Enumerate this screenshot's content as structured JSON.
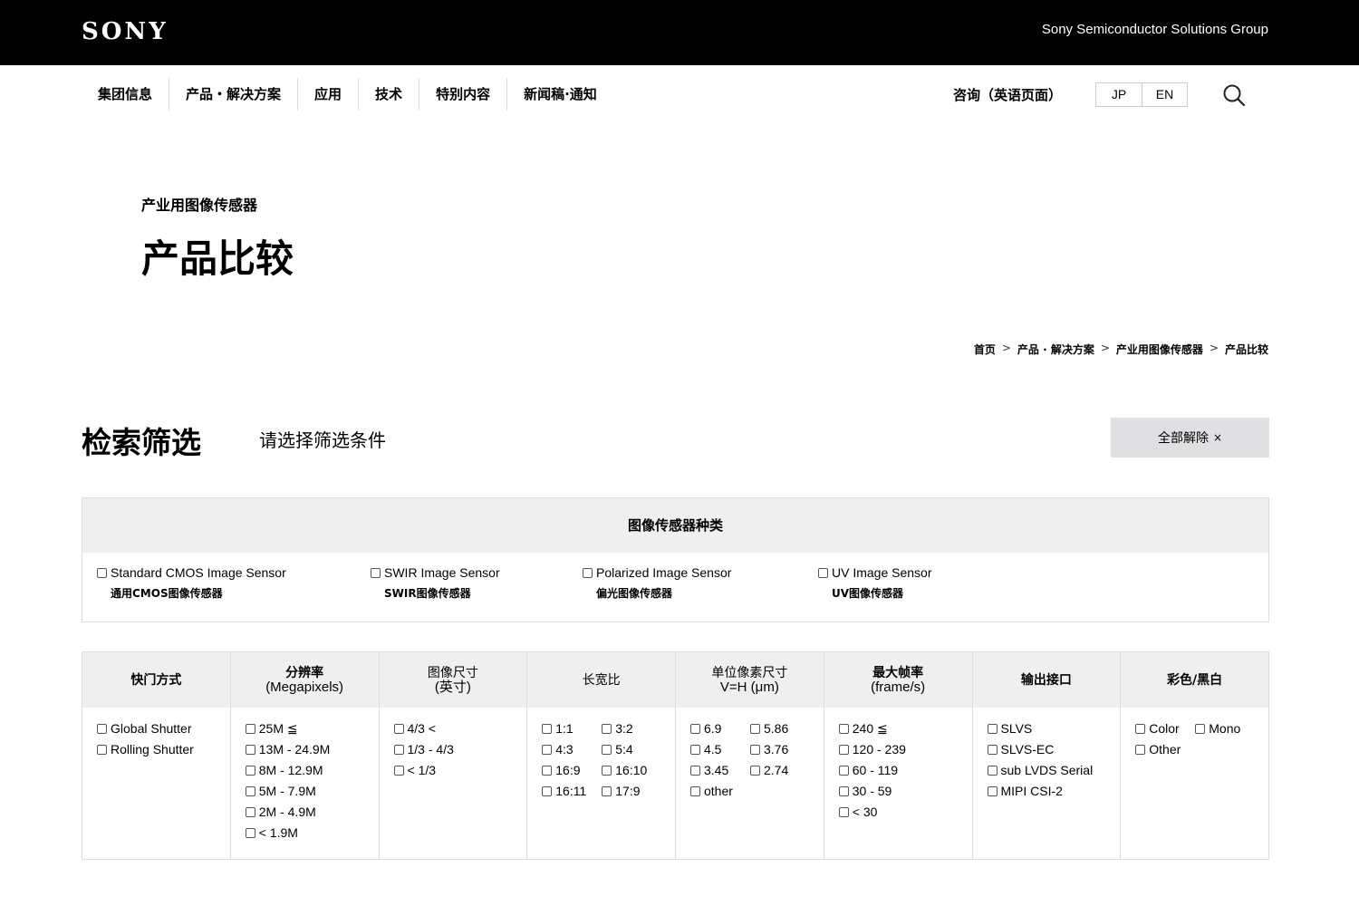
{
  "header": {
    "logo": "SONY",
    "group_name": "Sony Semiconductor Solutions Group"
  },
  "nav": {
    "items": [
      {
        "label": "集团信息"
      },
      {
        "label": "产品・解决方案"
      },
      {
        "label": "应用"
      },
      {
        "label": "技术"
      },
      {
        "label": "特别内容"
      },
      {
        "label": "新闻稿·通知"
      }
    ],
    "inquiry": "咨询（英语页面）",
    "lang_jp": "JP",
    "lang_en": "EN",
    "search_icon": "search-icon"
  },
  "page": {
    "category": "产业用图像传感器",
    "title": "产品比较"
  },
  "breadcrumb": {
    "items": [
      "首页",
      "产品 · 解决方案",
      "产业用图像传感器",
      "产品比较"
    ],
    "separator": ">"
  },
  "filter": {
    "title": "检索筛选",
    "hint": "请选择筛选条件",
    "clear_label": "全部解除",
    "clear_symbol": "×"
  },
  "sensor_type": {
    "heading": "图像传感器种类",
    "options": [
      {
        "label": "Standard CMOS Image Sensor",
        "sub": "通用CMOS图像传感器"
      },
      {
        "label": "SWIR Image Sensor",
        "sub": "SWIR图像传感器"
      },
      {
        "label": "Polarized Image Sensor",
        "sub": "偏光图像传感器"
      },
      {
        "label": "UV Image Sensor",
        "sub": "UV图像传感器"
      }
    ]
  },
  "spec_columns": [
    {
      "title": "快门方式",
      "subtitle": "",
      "options": [
        "Global Shutter",
        "Rolling Shutter"
      ]
    },
    {
      "title": "分辨率",
      "subtitle": "(Megapixels)",
      "options": [
        "25M ≦",
        "13M - 24.9M",
        "8M - 12.9M",
        "5M - 7.9M",
        "2M - 4.9M",
        "< 1.9M"
      ]
    },
    {
      "title": "图像尺寸",
      "subtitle": "(英寸)",
      "options": [
        "4/3 <",
        "1/3 - 4/3",
        "< 1/3"
      ]
    },
    {
      "title": "长宽比",
      "subtitle": "",
      "options": [
        "1:1",
        "3:2",
        "4:3",
        "5:4",
        "16:9",
        "16:10",
        "16:11",
        "17:9"
      ]
    },
    {
      "title": "单位像素尺寸",
      "subtitle": "V=H (μm)",
      "options": [
        "6.9",
        "5.86",
        "4.5",
        "3.76",
        "3.45",
        "2.74",
        "other"
      ]
    },
    {
      "title": "最大帧率",
      "subtitle": "(frame/s)",
      "options": [
        "240 ≦",
        "120 - 239",
        "60 - 119",
        "30 - 59",
        "< 30"
      ]
    },
    {
      "title": "输出接口",
      "subtitle": "",
      "options": [
        "SLVS",
        "SLVS-EC",
        "sub LVDS Serial",
        "MIPI CSI-2"
      ]
    },
    {
      "title": "彩色/黑白",
      "subtitle": "",
      "options": [
        "Color",
        "Mono",
        "Other"
      ]
    }
  ]
}
